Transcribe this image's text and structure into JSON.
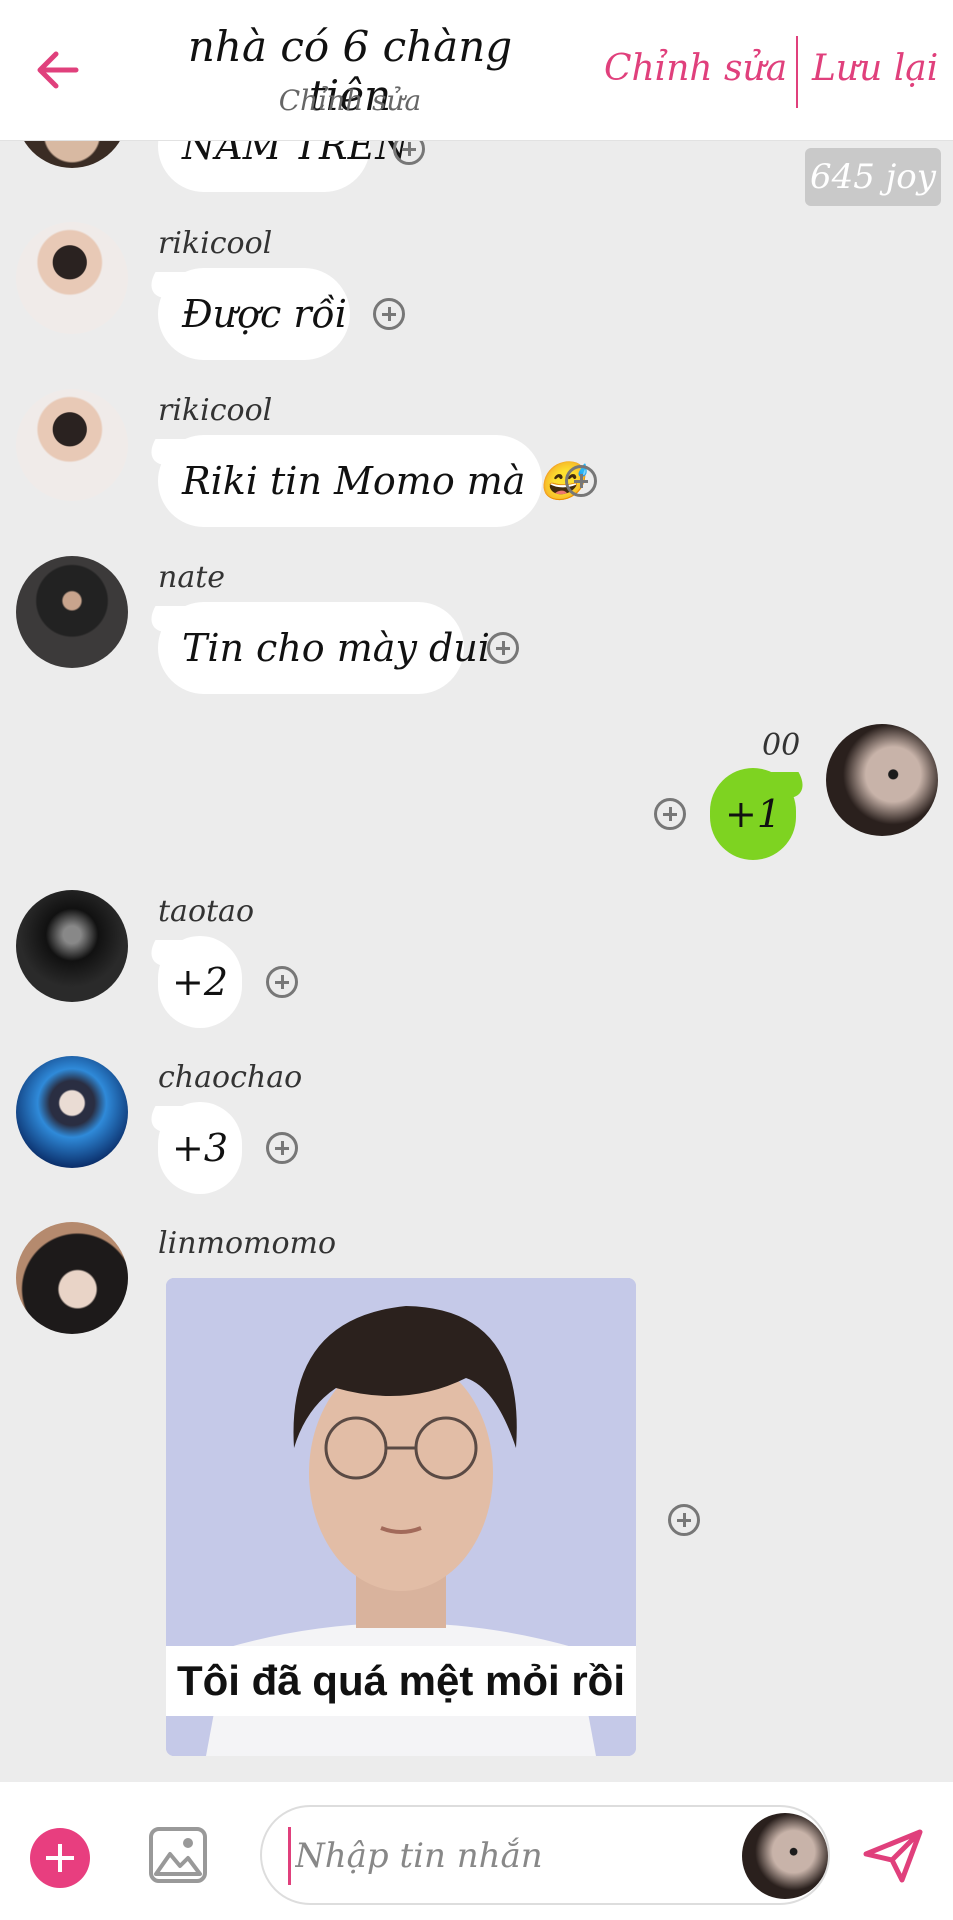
{
  "header": {
    "title": "nhà có 6 chàng tiên",
    "subtitle": "Chỉnh sửa",
    "edit_label": "Chỉnh sửa",
    "save_label": "Lưu lại"
  },
  "badge": "645 joy",
  "messages": [
    {
      "sender": "",
      "text": "NAM TREN"
    },
    {
      "sender": "rikicool",
      "text": "Được rồi"
    },
    {
      "sender": "rikicool",
      "text": "Riki tin Momo mà 😅"
    },
    {
      "sender": "nate",
      "text": "Tin cho mày dui"
    },
    {
      "sender": "00",
      "text": "+1"
    },
    {
      "sender": "taotao",
      "text": "+2"
    },
    {
      "sender": "chaochao",
      "text": "+3"
    },
    {
      "sender": "linmomomo",
      "text": ""
    }
  ],
  "meme": {
    "caption": "Tôi đã quá mệt mỏi rồi"
  },
  "composer": {
    "placeholder": "Nhập tin nhắn"
  },
  "colors": {
    "accent": "#e0407c",
    "my_bubble": "#7ed321",
    "background": "#ececec"
  }
}
